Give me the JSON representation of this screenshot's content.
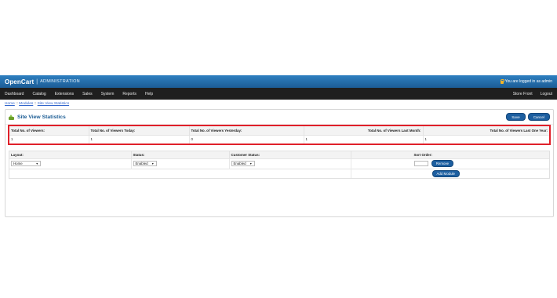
{
  "header": {
    "logo": "OpenCart",
    "separator": "|",
    "subtitle": "ADMINISTRATION",
    "logged_in": "You are logged in as admin"
  },
  "menu": {
    "items": [
      "Dashboard",
      "Catalog",
      "Extensions",
      "Sales",
      "System",
      "Reports",
      "Help"
    ],
    "right": [
      "Store Front",
      "Logout"
    ]
  },
  "breadcrumb": [
    "Home",
    "Modules",
    "Site View Statistics"
  ],
  "breadcrumb_sep": "::",
  "page": {
    "title": "Site View Statistics",
    "save": "Save",
    "cancel": "Cancel"
  },
  "stats": {
    "headers": [
      "Total No. of Viewers:",
      "Total No. of Viewers Today:",
      "Total No. of Viewers Yesterday:",
      "Total No. of Viewers Last Month:",
      "Total No. of Viewers Last One Year:"
    ],
    "values": [
      "1",
      "1",
      "0",
      "1",
      "1"
    ]
  },
  "module": {
    "headers": [
      "Layout:",
      "Status:",
      "Customer Status:",
      "Sort Order:"
    ],
    "row": {
      "layout": "Home",
      "status": "Enabled",
      "customer_status": "Enabled",
      "sort_order": ""
    },
    "remove": "Remove",
    "add": "Add Module"
  },
  "colors": {
    "accent": "#1d5fa0",
    "header": "#2e7fc0",
    "highlight": "#e0202a"
  }
}
